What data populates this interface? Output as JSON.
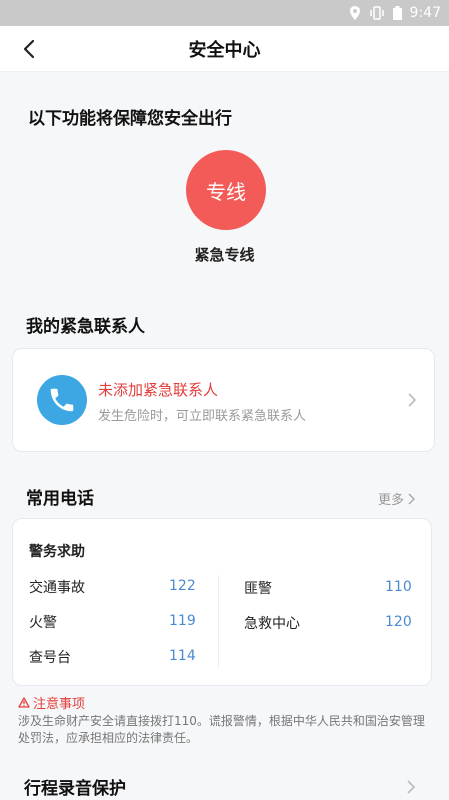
{
  "status_bar": {
    "time": "9:47",
    "icons": [
      "location-icon",
      "vibrate-icon",
      "battery-icon"
    ]
  },
  "header": {
    "title": "安全中心",
    "back_icon": "back-arrow-icon"
  },
  "intro": {
    "heading": "以下功能将保障您安全出行"
  },
  "hotline": {
    "circle_text": "专线",
    "label": "紧急专线",
    "color": "#f35b58"
  },
  "emergency_contacts": {
    "heading": "我的紧急联系人",
    "card": {
      "icon": "phone-icon",
      "title": "未添加紧急联系人",
      "subtitle": "发生危险时，可立即联系紧急联系人"
    }
  },
  "common_phones": {
    "heading": "常用电话",
    "more_label": "更多",
    "group_title": "警务求助",
    "left": [
      {
        "name": "交通事故",
        "number": "122"
      },
      {
        "name": "火警",
        "number": "119"
      },
      {
        "name": "查号台",
        "number": "114"
      }
    ],
    "right": [
      {
        "name": "匪警",
        "number": "110"
      },
      {
        "name": "急救中心",
        "number": "120"
      }
    ]
  },
  "notice": {
    "title": "注意事项",
    "icon": "warning-icon",
    "body": "涉及生命财产安全请直接拨打110。谎报警情，根据中华人民共和国治安管理处罚法，应承担相应的法律责任。"
  },
  "trip_recording": {
    "heading": "行程录音保护"
  },
  "colors": {
    "accent_red": "#e23d3b",
    "phone_blue": "#3ca7e2",
    "number_blue": "#4a8ad2"
  }
}
